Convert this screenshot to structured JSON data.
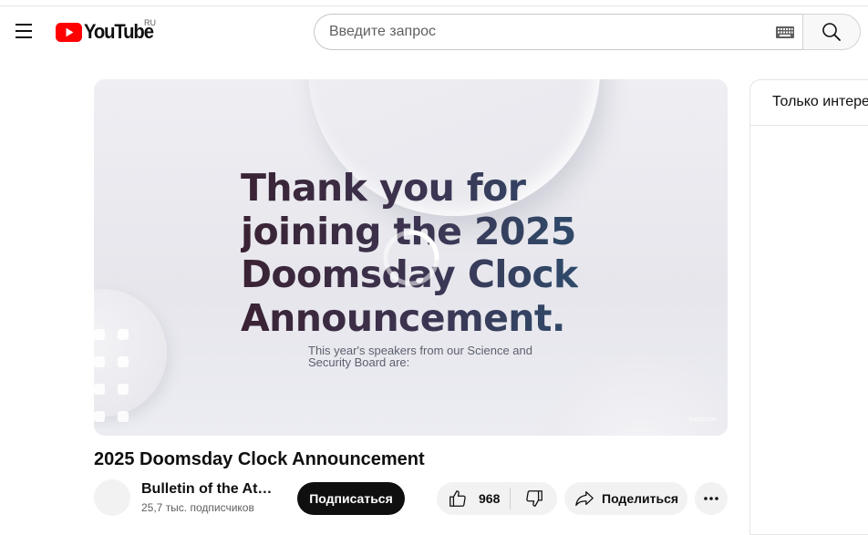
{
  "header": {
    "logo_text": "YouTube",
    "region_code": "RU",
    "search_placeholder": "Введите запрос",
    "icons": [
      "menu-icon",
      "keyboard-icon",
      "search-icon"
    ]
  },
  "player": {
    "slide_lines": [
      "Thank you for",
      "joining the 2025",
      "Doomsday Clock",
      "Announcement."
    ],
    "slide_subtitle_lines": [
      "This year's speakers from our Science and",
      "Security Board are:"
    ],
    "watermark": "Subscribe",
    "state": "loading"
  },
  "video": {
    "title": "2025 Doomsday Clock Announcement",
    "channel_name": "Bulletin of the Atomic Scientists",
    "subscribers": "25,7 тыс. подписчиков",
    "subscribe_label": "Подписаться",
    "like_count": "968",
    "share_label": "Поделиться"
  },
  "side_panel": {
    "title": "Только интересное"
  },
  "colors": {
    "brand_red": "#ff0000",
    "subscribe_bg": "#0f0f0f",
    "chip_bg": "#f2f2f2"
  }
}
